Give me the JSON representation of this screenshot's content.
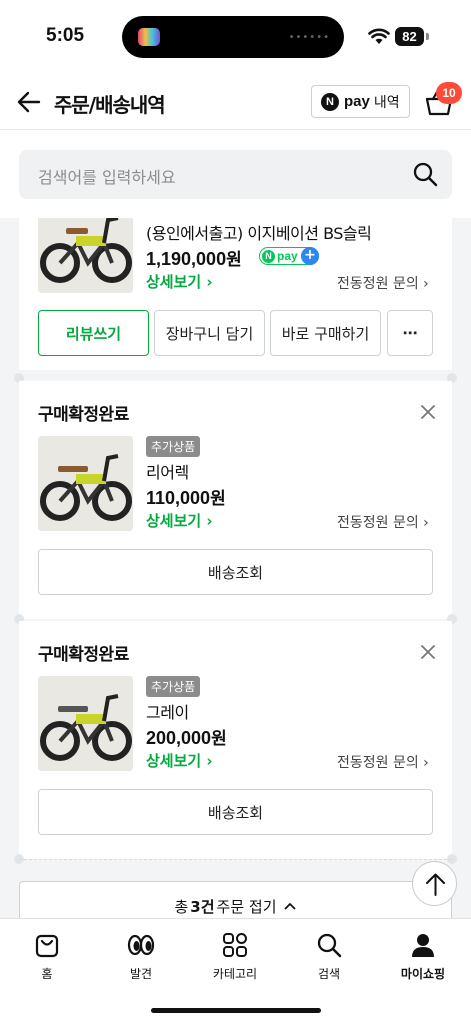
{
  "status_bar": {
    "time": "5:05",
    "battery": "82"
  },
  "header": {
    "title": "주문/배송내역",
    "npay_label": "pay",
    "npay_n": "N",
    "npay_history": "내역",
    "cart_count": "10"
  },
  "search": {
    "placeholder": "검색어를 입력하세요"
  },
  "orders": [
    {
      "name": "(용인에서출고) 이지베이션 BS슬릭",
      "price": "1,190,000",
      "currency": "원",
      "npay_badge": {
        "n": "N",
        "text": "pay",
        "plus": "+"
      },
      "detail_label": "상세보기 ›",
      "inquiry_label": "전동정원 문의 ›",
      "buttons": [
        "리뷰쓰기",
        "장바구니 담기",
        "바로 구매하기",
        "⋯"
      ]
    },
    {
      "status": "구매확정완료",
      "badge": "추가상품",
      "name": "리어렉",
      "price": "110,000",
      "currency": "원",
      "detail_label": "상세보기 ›",
      "inquiry_label": "전동정원 문의 ›",
      "track_label": "배송조회"
    },
    {
      "status": "구매확정완료",
      "badge": "추가상품",
      "name": "그레이",
      "price": "200,000",
      "currency": "원",
      "detail_label": "상세보기 ›",
      "inquiry_label": "전동정원 문의 ›",
      "track_label": "배송조회"
    }
  ],
  "fold": {
    "prefix": "총",
    "count": "3건",
    "suffix": "주문 접기"
  },
  "bottom_nav": [
    {
      "label": "홈",
      "icon": "home-bag-icon"
    },
    {
      "label": "발견",
      "icon": "eyes-icon"
    },
    {
      "label": "카테고리",
      "icon": "category-grid-icon"
    },
    {
      "label": "검색",
      "icon": "search-icon"
    },
    {
      "label": "마이쇼핑",
      "icon": "person-icon",
      "active": true
    }
  ],
  "colors": {
    "accent_green": "#05a83f",
    "npay_green": "#03c75a",
    "badge_red": "#ff4a3a",
    "bg_gray": "#f2f4f5"
  }
}
